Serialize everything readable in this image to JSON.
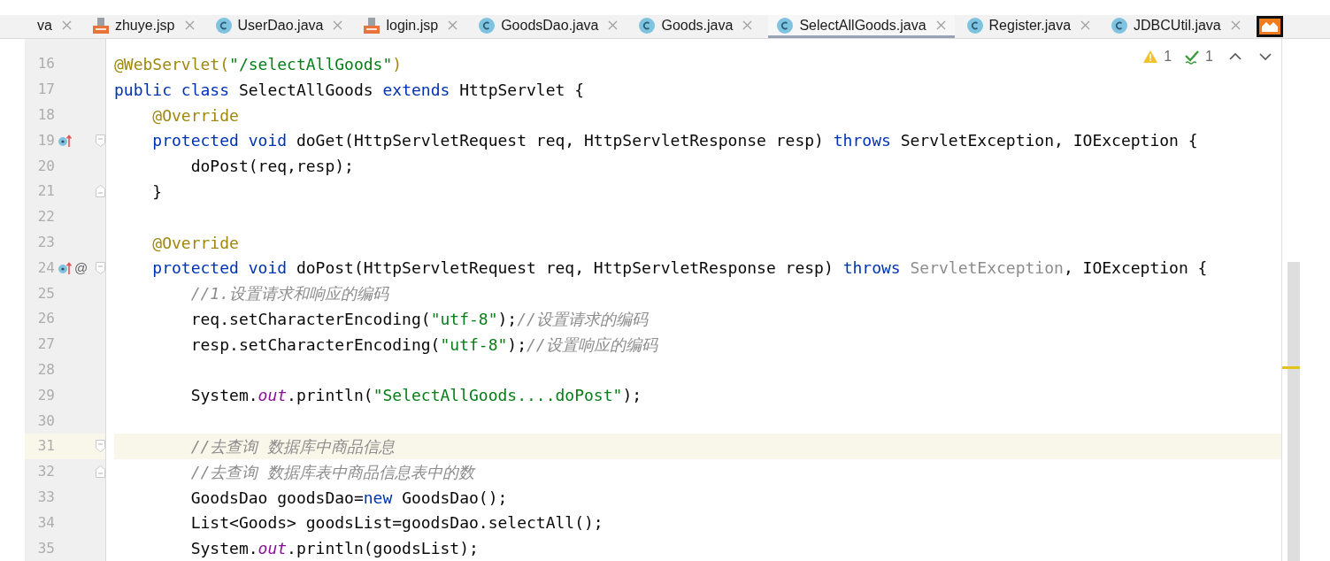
{
  "tabs": [
    {
      "label": "va",
      "kind": "none",
      "selected": false
    },
    {
      "label": "zhuye.jsp",
      "kind": "jsp",
      "selected": false
    },
    {
      "label": "UserDao.java",
      "kind": "class",
      "selected": false
    },
    {
      "label": "login.jsp",
      "kind": "jsp",
      "selected": false
    },
    {
      "label": "GoodsDao.java",
      "kind": "class",
      "selected": false
    },
    {
      "label": "Goods.java",
      "kind": "class",
      "selected": false
    },
    {
      "label": "SelectAllGoods.java",
      "kind": "class",
      "selected": true
    },
    {
      "label": "Register.java",
      "kind": "class",
      "selected": false
    },
    {
      "label": "JDBCUtil.java",
      "kind": "class",
      "selected": false
    }
  ],
  "inspections": {
    "warnings": "1",
    "weak_warnings": "1"
  },
  "lines": [
    {
      "number": "16",
      "override_marker": false,
      "fold_open": false,
      "fold_close": false,
      "current": false,
      "tokens": [
        {
          "text": "@WebServlet(",
          "kind": "annotation"
        },
        {
          "text": "\"/selectAllGoods\"",
          "kind": "string"
        },
        {
          "text": ")",
          "kind": "annotation"
        }
      ]
    },
    {
      "number": "17",
      "override_marker": false,
      "fold_open": false,
      "fold_close": false,
      "current": false,
      "tokens": [
        {
          "text": "public class ",
          "kind": "keyword"
        },
        {
          "text": "SelectAllGoods ",
          "kind": "plain"
        },
        {
          "text": "extends ",
          "kind": "keyword"
        },
        {
          "text": "HttpServlet {",
          "kind": "plain"
        }
      ]
    },
    {
      "number": "18",
      "override_marker": false,
      "fold_open": false,
      "fold_close": false,
      "current": false,
      "tokens": [
        {
          "text": "    @Override",
          "kind": "annotation"
        }
      ]
    },
    {
      "number": "19",
      "override_marker": true,
      "fold_open": true,
      "fold_close": false,
      "current": false,
      "tokens": [
        {
          "text": "    protected void ",
          "kind": "keyword"
        },
        {
          "text": "doGet(HttpServletRequest req, HttpServletResponse resp) ",
          "kind": "plain"
        },
        {
          "text": "throws ",
          "kind": "keyword"
        },
        {
          "text": "ServletException, IOException {",
          "kind": "plain"
        }
      ]
    },
    {
      "number": "20",
      "override_marker": false,
      "fold_open": false,
      "fold_close": false,
      "current": false,
      "tokens": [
        {
          "text": "        doPost(req,resp);",
          "kind": "plain"
        }
      ]
    },
    {
      "number": "21",
      "override_marker": false,
      "fold_open": false,
      "fold_close": true,
      "current": false,
      "tokens": [
        {
          "text": "    }",
          "kind": "plain"
        }
      ]
    },
    {
      "number": "22",
      "override_marker": false,
      "fold_open": false,
      "fold_close": false,
      "current": false
    },
    {
      "number": "23",
      "override_marker": false,
      "fold_open": false,
      "fold_close": false,
      "current": false,
      "tokens": [
        {
          "text": "    @Override",
          "kind": "annotation"
        }
      ]
    },
    {
      "number": "24",
      "override_marker": true,
      "extra": "@",
      "fold_open": true,
      "fold_close": false,
      "current": false,
      "tokens": [
        {
          "text": "    protected void ",
          "kind": "keyword"
        },
        {
          "text": "doPost(HttpServletRequest req, HttpServletResponse resp) ",
          "kind": "plain"
        },
        {
          "text": "throws ",
          "kind": "keyword"
        },
        {
          "text": "ServletException",
          "kind": "unused"
        },
        {
          "text": ", IOException {",
          "kind": "plain"
        }
      ]
    },
    {
      "number": "25",
      "override_marker": false,
      "fold_open": false,
      "fold_close": false,
      "current": false,
      "tokens": [
        {
          "text": "        //1.设置请求和响应的编码",
          "kind": "comment"
        }
      ]
    },
    {
      "number": "26",
      "override_marker": false,
      "fold_open": false,
      "fold_close": false,
      "current": false,
      "tokens": [
        {
          "text": "        req.setCharacterEncoding(",
          "kind": "plain"
        },
        {
          "text": "\"utf-8\"",
          "kind": "string"
        },
        {
          "text": ");",
          "kind": "plain"
        },
        {
          "text": "//设置请求的编码",
          "kind": "comment"
        }
      ]
    },
    {
      "number": "27",
      "override_marker": false,
      "fold_open": false,
      "fold_close": false,
      "current": false,
      "tokens": [
        {
          "text": "        resp.setCharacterEncoding(",
          "kind": "plain"
        },
        {
          "text": "\"utf-8\"",
          "kind": "string"
        },
        {
          "text": ");",
          "kind": "plain"
        },
        {
          "text": "//设置响应的编码",
          "kind": "comment"
        }
      ]
    },
    {
      "number": "28",
      "override_marker": false,
      "fold_open": false,
      "fold_close": false,
      "current": false
    },
    {
      "number": "29",
      "override_marker": false,
      "fold_open": false,
      "fold_close": false,
      "current": false,
      "tokens": [
        {
          "text": "        System.",
          "kind": "plain"
        },
        {
          "text": "out",
          "kind": "field"
        },
        {
          "text": ".println(",
          "kind": "plain"
        },
        {
          "text": "\"SelectAllGoods....doPost\"",
          "kind": "string"
        },
        {
          "text": ");",
          "kind": "plain"
        }
      ]
    },
    {
      "number": "30",
      "override_marker": false,
      "fold_open": false,
      "fold_close": false,
      "current": false
    },
    {
      "number": "31",
      "override_marker": false,
      "fold_open": true,
      "fold_close": false,
      "current": true,
      "tokens": [
        {
          "text": "        //去查询 数据库中商品信息",
          "kind": "comment"
        }
      ]
    },
    {
      "number": "32",
      "override_marker": false,
      "fold_open": false,
      "fold_close": true,
      "current": false,
      "tokens": [
        {
          "text": "        //去查询 数据库表中商品信息表中的数",
          "kind": "comment"
        }
      ]
    },
    {
      "number": "33",
      "override_marker": false,
      "fold_open": false,
      "fold_close": false,
      "current": false,
      "tokens": [
        {
          "text": "        GoodsDao goodsDao=",
          "kind": "plain"
        },
        {
          "text": "new ",
          "kind": "keyword"
        },
        {
          "text": "GoodsDao();",
          "kind": "plain"
        }
      ]
    },
    {
      "number": "34",
      "override_marker": false,
      "fold_open": false,
      "fold_close": false,
      "current": false,
      "tokens": [
        {
          "text": "        List<Goods> goodsList=goodsDao.selectAll();",
          "kind": "plain"
        }
      ]
    },
    {
      "number": "35",
      "override_marker": false,
      "fold_open": false,
      "fold_close": false,
      "current": false,
      "tokens": [
        {
          "text": "        System.",
          "kind": "plain"
        },
        {
          "text": "out",
          "kind": "field"
        },
        {
          "text": ".println(goodsList);",
          "kind": "plain"
        }
      ]
    }
  ]
}
